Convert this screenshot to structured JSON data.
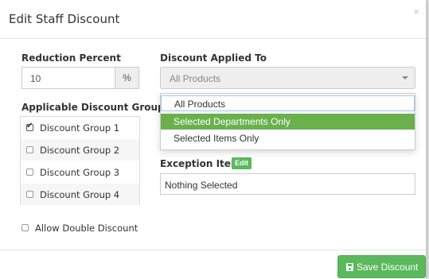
{
  "modal": {
    "title": "Edit Staff Discount",
    "close_glyph": "×"
  },
  "reduction": {
    "label": "Reduction Percent",
    "value": "10",
    "unit": "%"
  },
  "applied_to": {
    "label": "Discount Applied To",
    "selected": "All Products",
    "options": [
      "All Products",
      "Selected Departments Only",
      "Selected Items Only"
    ],
    "highlighted_option": "Selected Departments Only"
  },
  "groups": {
    "label": "Applicable Discount Groups",
    "items": [
      {
        "label": "Discount Group 1",
        "checked": true
      },
      {
        "label": "Discount Group 2",
        "checked": false
      },
      {
        "label": "Discount Group 3",
        "checked": false
      },
      {
        "label": "Discount Group 4",
        "checked": false
      }
    ]
  },
  "exceptions": {
    "label": "Exception Items",
    "edit_label": "Edit",
    "value": "Nothing Selected"
  },
  "allow_double": {
    "label": "Allow Double Discount",
    "checked": false
  },
  "footer": {
    "save_label": "Save Discount",
    "save_icon": "floppy-disk-icon"
  },
  "colors": {
    "accent_green": "#5cb85c",
    "highlight_green": "#6ab04c"
  }
}
